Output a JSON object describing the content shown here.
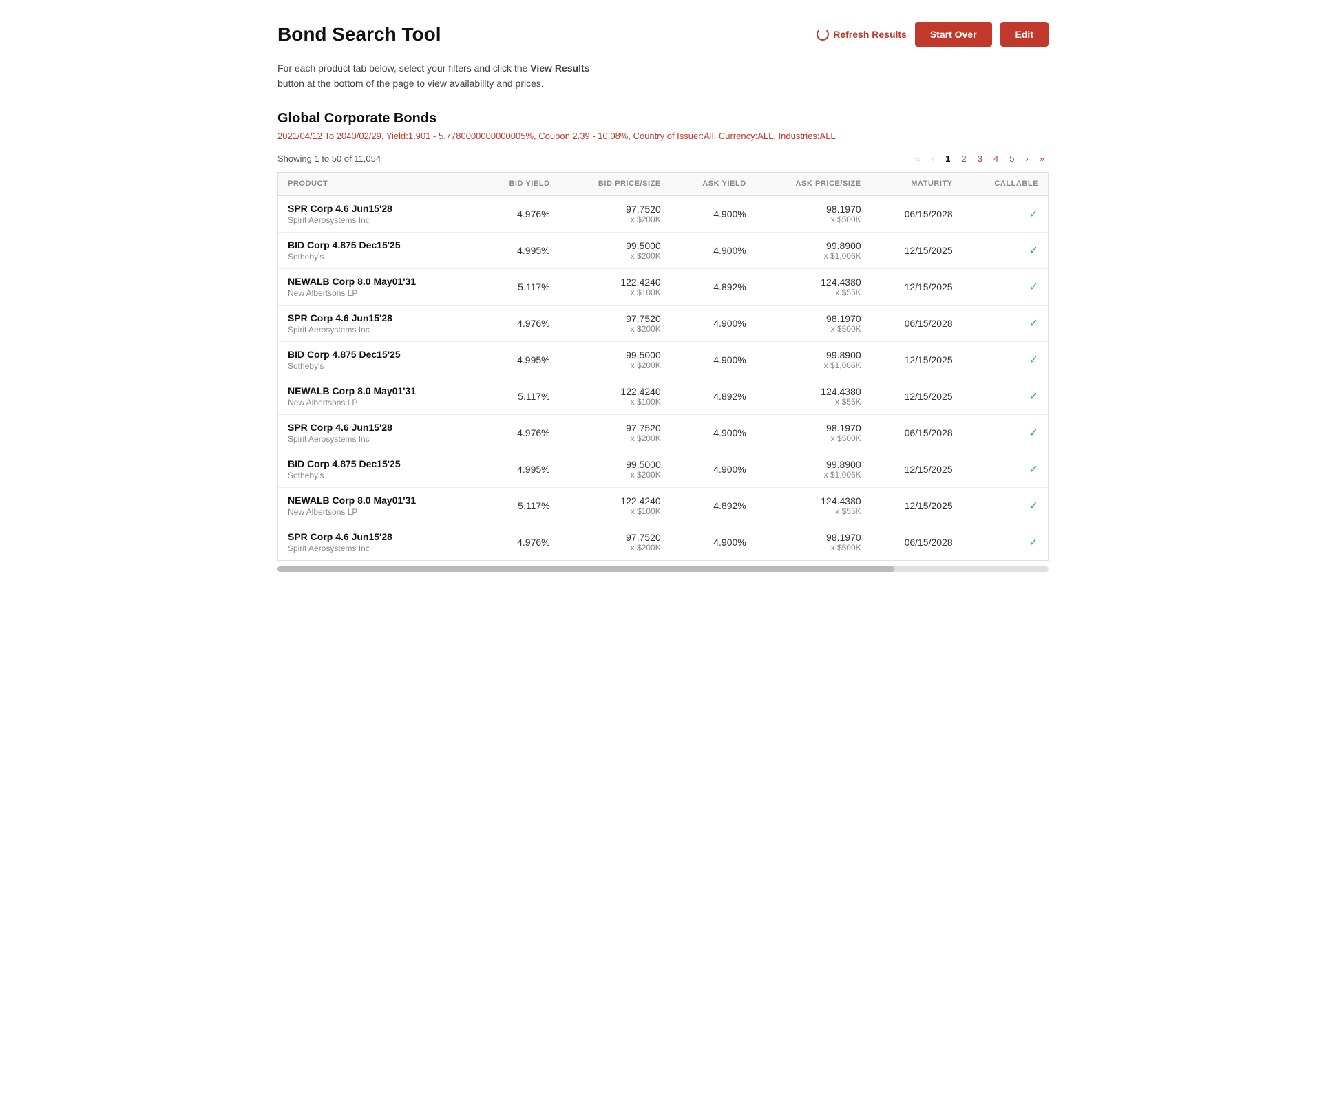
{
  "header": {
    "title": "Bond Search Tool",
    "refresh_label": "Refresh Results",
    "start_over_label": "Start Over",
    "edit_label": "Edit"
  },
  "description": {
    "text_before": "For each product tab below, select your filters and click the ",
    "highlight": "View Results",
    "text_after": " button at the bottom of the page to view availability and prices."
  },
  "section": {
    "title": "Global Corporate Bonds",
    "filter_summary": "2021/04/12 To 2040/02/29, Yield:1.901 - 5.7780000000000005%, Coupon:2.39 - 10.08%, Country of Issuer:All, Currency:ALL, Industries:ALL"
  },
  "results": {
    "showing": "Showing 1 to 50 of 11,054"
  },
  "pagination": {
    "first": "«",
    "prev": "‹",
    "pages": [
      "1",
      "2",
      "3",
      "4",
      "5"
    ],
    "active_page": "1",
    "next": "›",
    "last": "»"
  },
  "table": {
    "columns": [
      "PRODUCT",
      "BID YIELD",
      "BID PRICE/SIZE",
      "ASK YIELD",
      "ASK PRICE/SIZE",
      "MATURITY",
      "CALLABLE"
    ],
    "rows": [
      {
        "product_name": "SPR Corp 4.6 Jun15'28",
        "product_sub": "Spirit Aerosystems Inc",
        "bid_yield": "4.976%",
        "bid_price": "97.7520",
        "bid_size": "x $200K",
        "ask_yield": "4.900%",
        "ask_price": "98.1970",
        "ask_size": "x $500K",
        "maturity": "06/15/2028",
        "callable": true
      },
      {
        "product_name": "BID Corp 4.875 Dec15'25",
        "product_sub": "Sotheby's",
        "bid_yield": "4.995%",
        "bid_price": "99.5000",
        "bid_size": "x $200K",
        "ask_yield": "4.900%",
        "ask_price": "99.8900",
        "ask_size": "x $1,006K",
        "maturity": "12/15/2025",
        "callable": true
      },
      {
        "product_name": "NEWALB Corp 8.0 May01'31",
        "product_sub": "New Albertsons LP",
        "bid_yield": "5.117%",
        "bid_price": "122.4240",
        "bid_size": "x $100K",
        "ask_yield": "4.892%",
        "ask_price": "124.4380",
        "ask_size": "x $55K",
        "maturity": "12/15/2025",
        "callable": true
      },
      {
        "product_name": "SPR Corp 4.6 Jun15'28",
        "product_sub": "Spirit Aerosystems Inc",
        "bid_yield": "4.976%",
        "bid_price": "97.7520",
        "bid_size": "x $200K",
        "ask_yield": "4.900%",
        "ask_price": "98.1970",
        "ask_size": "x $500K",
        "maturity": "06/15/2028",
        "callable": true
      },
      {
        "product_name": "BID Corp 4.875 Dec15'25",
        "product_sub": "Sotheby's",
        "bid_yield": "4.995%",
        "bid_price": "99.5000",
        "bid_size": "x $200K",
        "ask_yield": "4.900%",
        "ask_price": "99.8900",
        "ask_size": "x $1,006K",
        "maturity": "12/15/2025",
        "callable": true
      },
      {
        "product_name": "NEWALB Corp 8.0 May01'31",
        "product_sub": "New Albertsons LP",
        "bid_yield": "5.117%",
        "bid_price": "122.4240",
        "bid_size": "x $100K",
        "ask_yield": "4.892%",
        "ask_price": "124.4380",
        "ask_size": "x $55K",
        "maturity": "12/15/2025",
        "callable": true
      },
      {
        "product_name": "SPR Corp 4.6 Jun15'28",
        "product_sub": "Spirit Aerosystems Inc",
        "bid_yield": "4.976%",
        "bid_price": "97.7520",
        "bid_size": "x $200K",
        "ask_yield": "4.900%",
        "ask_price": "98.1970",
        "ask_size": "x $500K",
        "maturity": "06/15/2028",
        "callable": true
      },
      {
        "product_name": "BID Corp 4.875 Dec15'25",
        "product_sub": "Sotheby's",
        "bid_yield": "4.995%",
        "bid_price": "99.5000",
        "bid_size": "x $200K",
        "ask_yield": "4.900%",
        "ask_price": "99.8900",
        "ask_size": "x $1,006K",
        "maturity": "12/15/2025",
        "callable": true
      },
      {
        "product_name": "NEWALB Corp 8.0 May01'31",
        "product_sub": "New Albertsons LP",
        "bid_yield": "5.117%",
        "bid_price": "122.4240",
        "bid_size": "x $100K",
        "ask_yield": "4.892%",
        "ask_price": "124.4380",
        "ask_size": "x $55K",
        "maturity": "12/15/2025",
        "callable": true
      },
      {
        "product_name": "SPR Corp 4.6 Jun15'28",
        "product_sub": "Spirit Aerosystems Inc",
        "bid_yield": "4.976%",
        "bid_price": "97.7520",
        "bid_size": "x $200K",
        "ask_yield": "4.900%",
        "ask_price": "98.1970",
        "ask_size": "x $500K",
        "maturity": "06/15/2028",
        "callable": true
      }
    ]
  }
}
